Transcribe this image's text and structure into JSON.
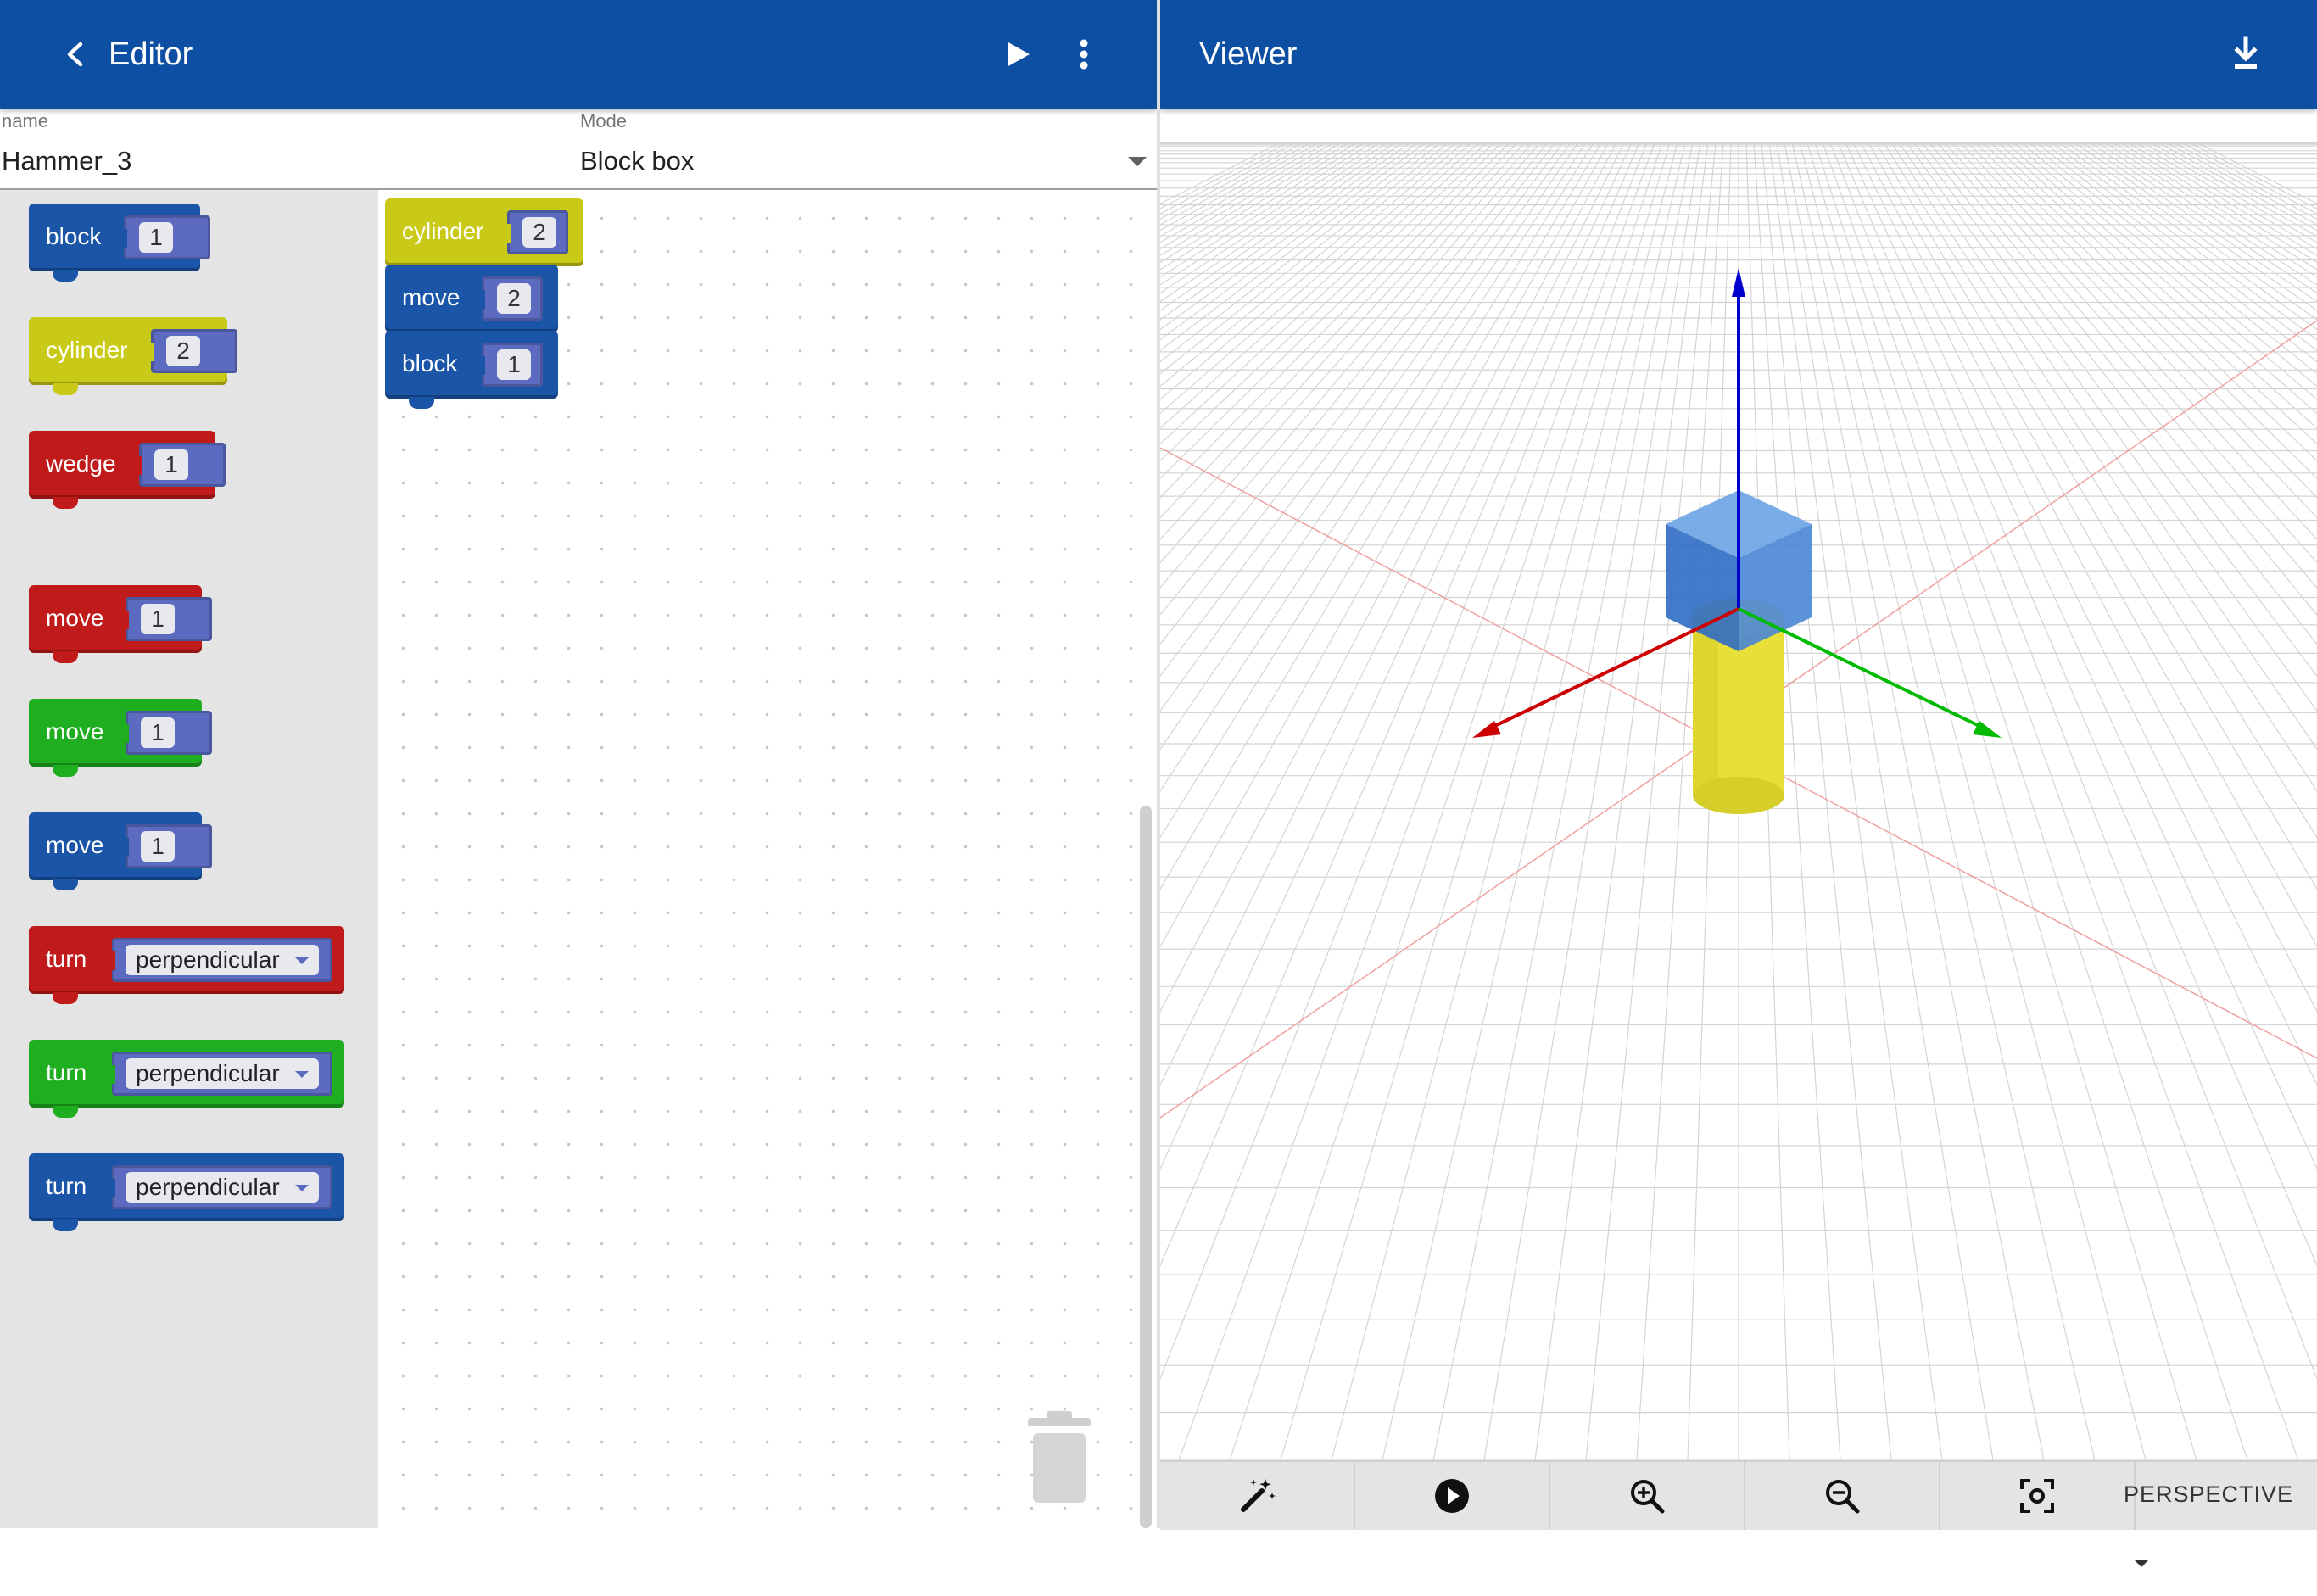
{
  "editor": {
    "title": "Editor",
    "name_label": "name",
    "name_value": "Hammer_3",
    "mode_label": "Mode",
    "mode_value": "Block box"
  },
  "viewer": {
    "title": "Viewer",
    "projection": "PERSPECTIVE"
  },
  "colors": {
    "appbar": "#0d4fa3",
    "block_blue": "#1a55a8",
    "block_yellow": "#c9c917",
    "block_red": "#c11a1a",
    "block_green": "#1fae1f",
    "axis_x": "#cc0000",
    "axis_y": "#00bb00",
    "axis_z": "#0000cc"
  },
  "toolbox": [
    {
      "label": "block",
      "value": "1",
      "color": "blue"
    },
    {
      "label": "cylinder",
      "value": "2",
      "color": "yellow"
    },
    {
      "label": "wedge",
      "value": "1",
      "color": "red"
    },
    {
      "label": "move",
      "value": "1",
      "color": "red"
    },
    {
      "label": "move",
      "value": "1",
      "color": "green"
    },
    {
      "label": "move",
      "value": "1",
      "color": "blue"
    },
    {
      "label": "turn",
      "value": "perpendicular",
      "color": "red"
    },
    {
      "label": "turn",
      "value": "perpendicular",
      "color": "green"
    },
    {
      "label": "turn",
      "value": "perpendicular",
      "color": "blue"
    }
  ],
  "workspace_stack": [
    {
      "label": "cylinder",
      "value": "2",
      "color": "yellow"
    },
    {
      "label": "move",
      "value": "2",
      "color": "blue"
    },
    {
      "label": "block",
      "value": "1",
      "color": "blue"
    }
  ],
  "icons": {
    "back": "chevron-left-icon",
    "run": "play-icon",
    "menu": "more-vert-icon",
    "download": "download-icon",
    "trash": "trash-icon",
    "wand": "magic-wand-icon",
    "play_circle": "play-circle-icon",
    "zoom_in": "zoom-in-icon",
    "zoom_out": "zoom-out-icon",
    "focus": "center-focus-icon",
    "dropdown": "caret-down-icon"
  }
}
